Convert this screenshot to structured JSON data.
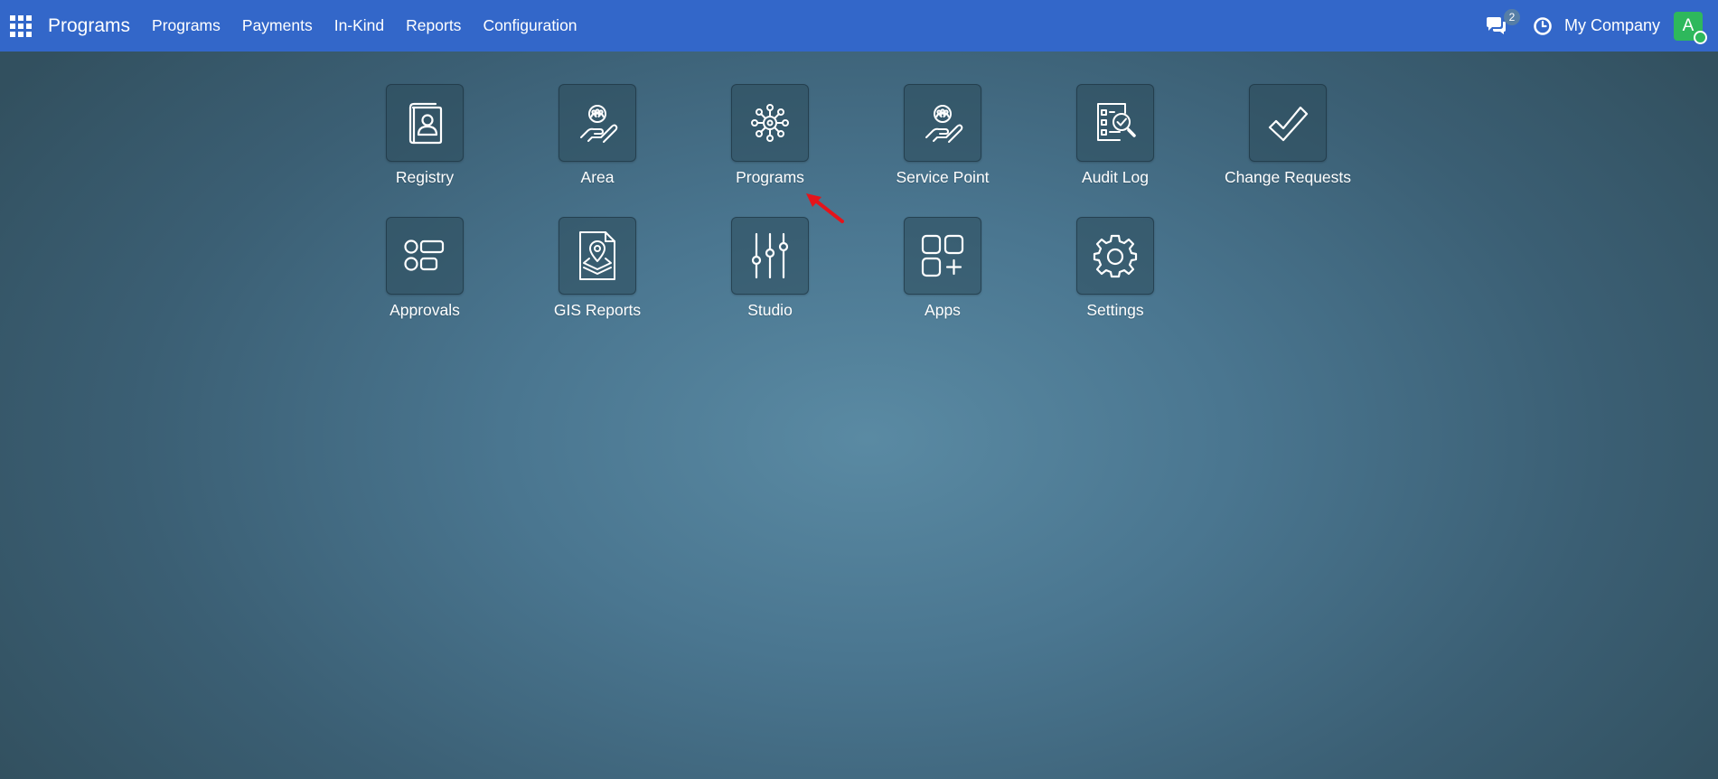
{
  "navbar": {
    "brand": "Programs",
    "menu": [
      "Programs",
      "Payments",
      "In-Kind",
      "Reports",
      "Configuration"
    ],
    "messages_badge": "2",
    "company": "My Company",
    "avatar_letter": "A"
  },
  "apps": [
    {
      "label": "Registry",
      "icon": "registry-icon"
    },
    {
      "label": "Area",
      "icon": "area-icon"
    },
    {
      "label": "Programs",
      "icon": "programs-icon"
    },
    {
      "label": "Service Point",
      "icon": "service-point-icon"
    },
    {
      "label": "Audit Log",
      "icon": "audit-log-icon"
    },
    {
      "label": "Change Requests",
      "icon": "change-requests-icon"
    },
    {
      "label": "Approvals",
      "icon": "approvals-icon"
    },
    {
      "label": "GIS Reports",
      "icon": "gis-reports-icon"
    },
    {
      "label": "Studio",
      "icon": "studio-icon"
    },
    {
      "label": "Apps",
      "icon": "apps-icon"
    },
    {
      "label": "Settings",
      "icon": "settings-icon"
    }
  ],
  "colors": {
    "navbar": "#3367c9",
    "avatar": "#2eb85c",
    "annotation_arrow": "#e4141b"
  }
}
